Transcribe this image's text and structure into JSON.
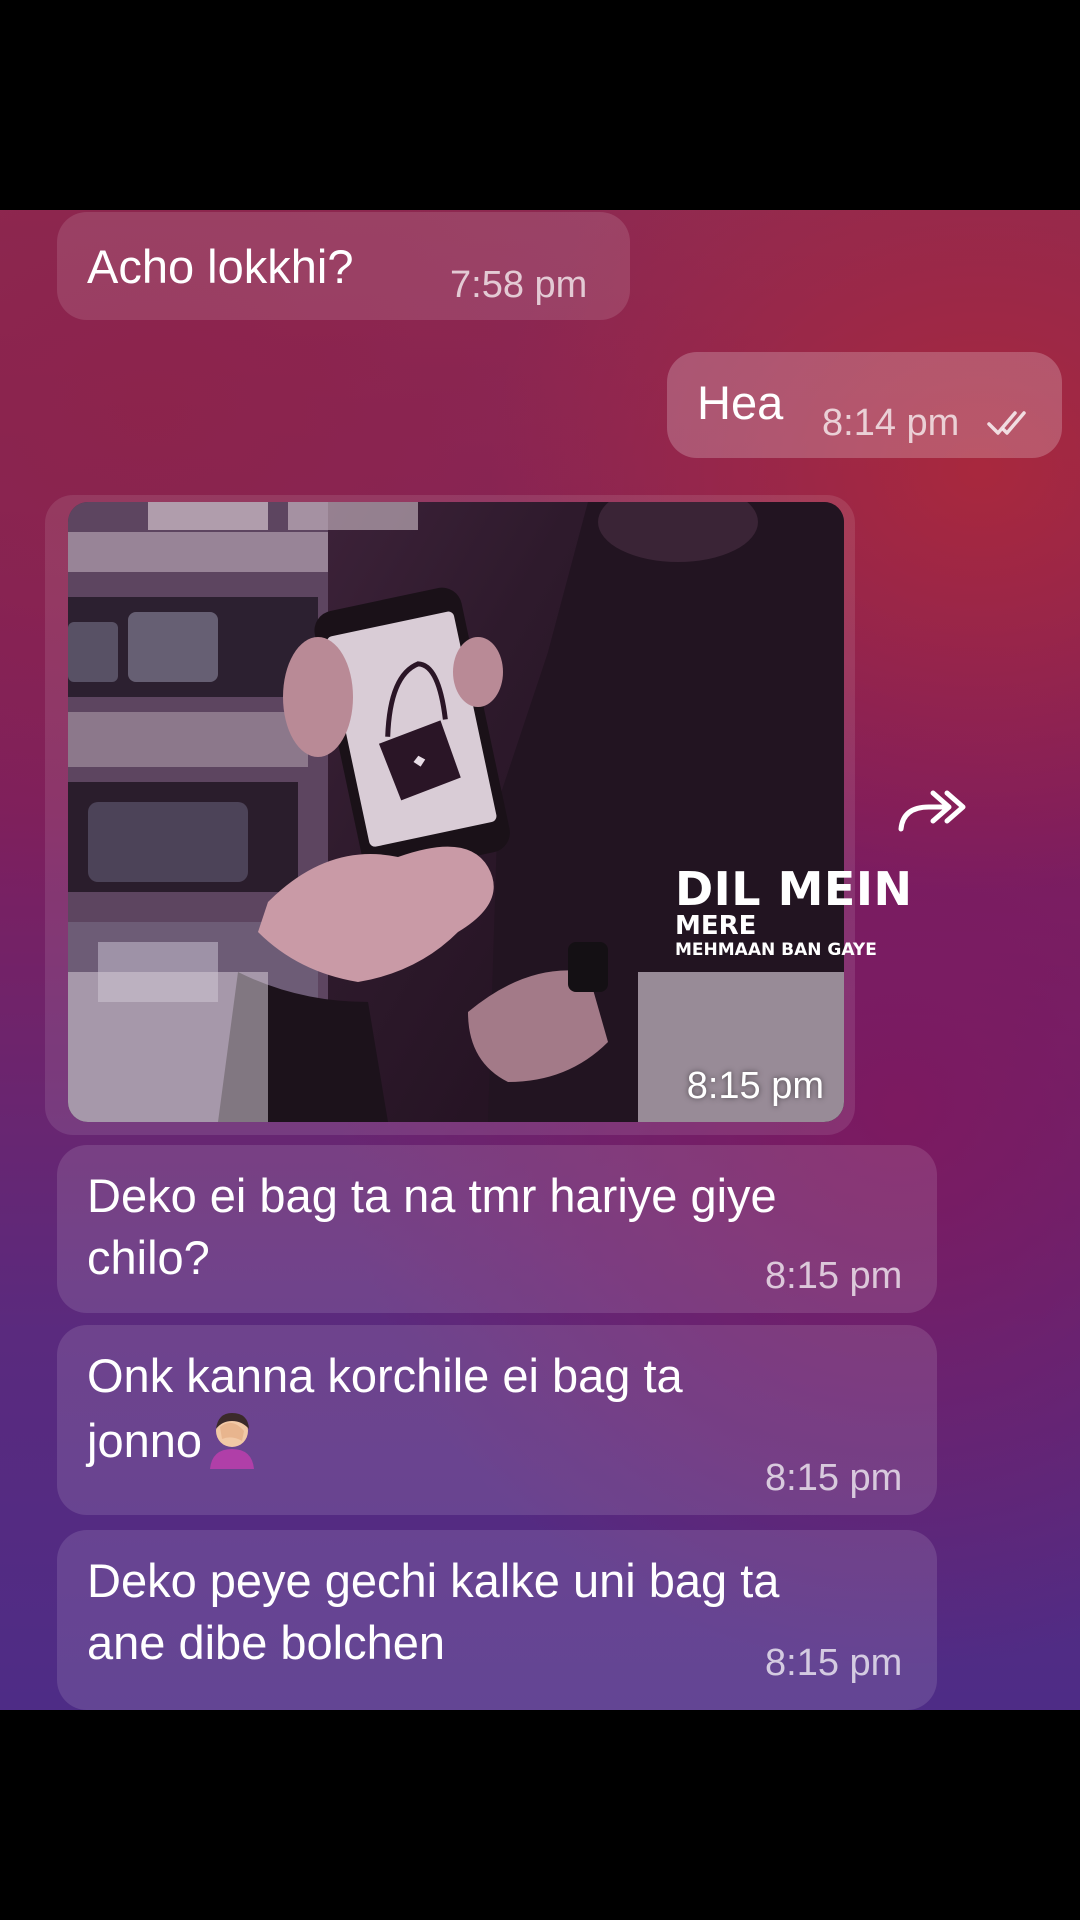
{
  "messages": [
    {
      "text": "Acho lokkhi?",
      "time": "7:58 pm"
    },
    {
      "text": "Hea",
      "time": "8:14 pm"
    },
    {
      "time": "8:15 pm"
    },
    {
      "text": "Deko ei bag ta na tmr hariye giye\nchilo?",
      "time": "8:15 pm"
    },
    {
      "text": "Onk kanna korchile ei bag ta\njonno",
      "time": "8:15 pm"
    },
    {
      "text": "Deko peye gechi kalke uni bag ta\nane dibe bolchen",
      "time": "8:15 pm"
    }
  ],
  "overlay": {
    "line1": "DIL MEIN",
    "line2": "MERE",
    "line3": "MEHMAAN BAN GAYE"
  },
  "icons": {
    "read_receipt": "double-check-icon",
    "forward": "forward-arrow-icon",
    "emoji": "facepalm-emoji"
  },
  "colors": {
    "incoming_bubble": "#ffffff1f",
    "outgoing_bubble": "#ffffff38",
    "bg_top": "#8e2a52",
    "bg_bottom": "#4e2c86"
  }
}
